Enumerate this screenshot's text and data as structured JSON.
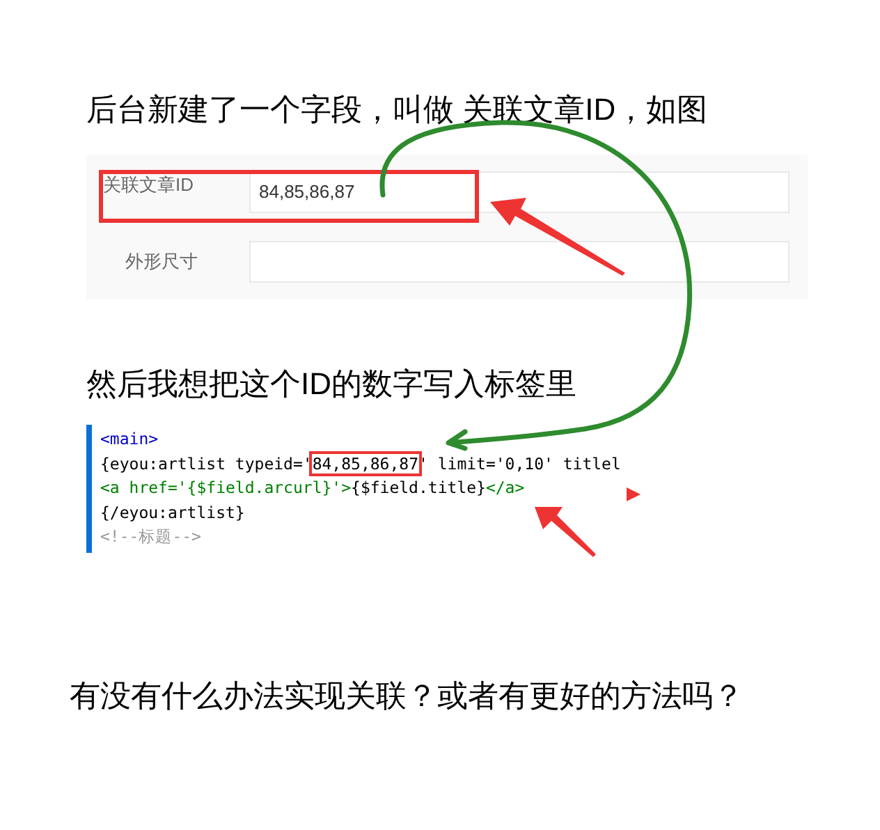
{
  "heading": "后台新建了一个字段，叫做 关联文章ID，如图",
  "form": {
    "fields": [
      {
        "label": "关联文章ID",
        "value": "84,85,86,87",
        "highlighted": true
      },
      {
        "label": "外形尺寸",
        "highlighted": false
      }
    ]
  },
  "subheading": "然后我想把这个ID的数字写入标签里",
  "code": {
    "lines": [
      [
        {
          "text": "<main>",
          "kind": "tag"
        }
      ],
      [
        {
          "text": "{eyou:artlist typeid='",
          "kind": "plain"
        },
        {
          "text": "84,85,86,87",
          "kind": "highlight"
        },
        {
          "text": "' limit='0,10' titlel",
          "kind": "plain"
        }
      ],
      [
        {
          "text": "<a href='{$field.arcurl}'>",
          "kind": "green"
        },
        {
          "text": "{$field.title}",
          "kind": "plain"
        },
        {
          "text": "</a>",
          "kind": "green"
        }
      ],
      [
        {
          "text": "{/eyou:artlist}",
          "kind": "plain"
        }
      ],
      [
        {
          "text": "<!--标题-->",
          "kind": "comment"
        }
      ]
    ]
  },
  "question": "有没有什么办法实现关联？或者有更好的方法吗？"
}
